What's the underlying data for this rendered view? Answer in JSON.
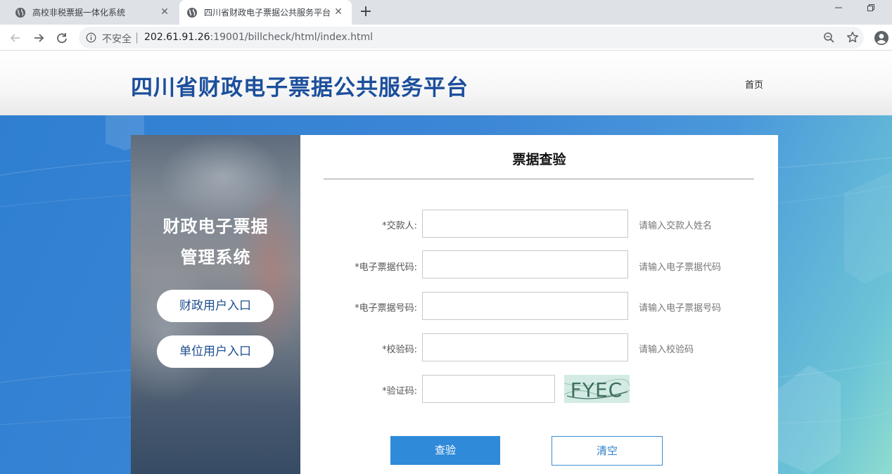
{
  "browser": {
    "tabs": [
      {
        "title": "高校非税票据一体化系统",
        "active": false
      },
      {
        "title": "四川省财政电子票据公共服务平台",
        "active": true
      }
    ],
    "new_tab_icon": "plus-icon",
    "omnibox": {
      "security_label": "不安全",
      "separator": "|",
      "url_host": "202.61.91.26",
      "url_rest": ":19001/billcheck/html/index.html"
    }
  },
  "header": {
    "site_title": "四川省财政电子票据公共服务平台",
    "nav_home": "首页",
    "title_color": "#1c4f9c"
  },
  "left_panel": {
    "title_line1": "财政电子票据",
    "title_line2": "管理系统",
    "buttons": [
      "财政用户入口",
      "单位用户入口"
    ]
  },
  "form": {
    "title": "票据查验",
    "fields": [
      {
        "label": "*交款人:",
        "value": "",
        "hint": "请输入交款人姓名"
      },
      {
        "label": "*电子票据代码:",
        "value": "",
        "hint": "请输入电子票据代码"
      },
      {
        "label": "*电子票据号码:",
        "value": "",
        "hint": "请输入电子票据号码"
      },
      {
        "label": "*校验码:",
        "value": "",
        "hint": "请输入校验码"
      },
      {
        "label": "*验证码:",
        "value": ""
      }
    ],
    "captcha_text": "FYEC",
    "buttons": {
      "query": "查验",
      "clear": "清空"
    },
    "accent_color": "#2f8ad9"
  }
}
